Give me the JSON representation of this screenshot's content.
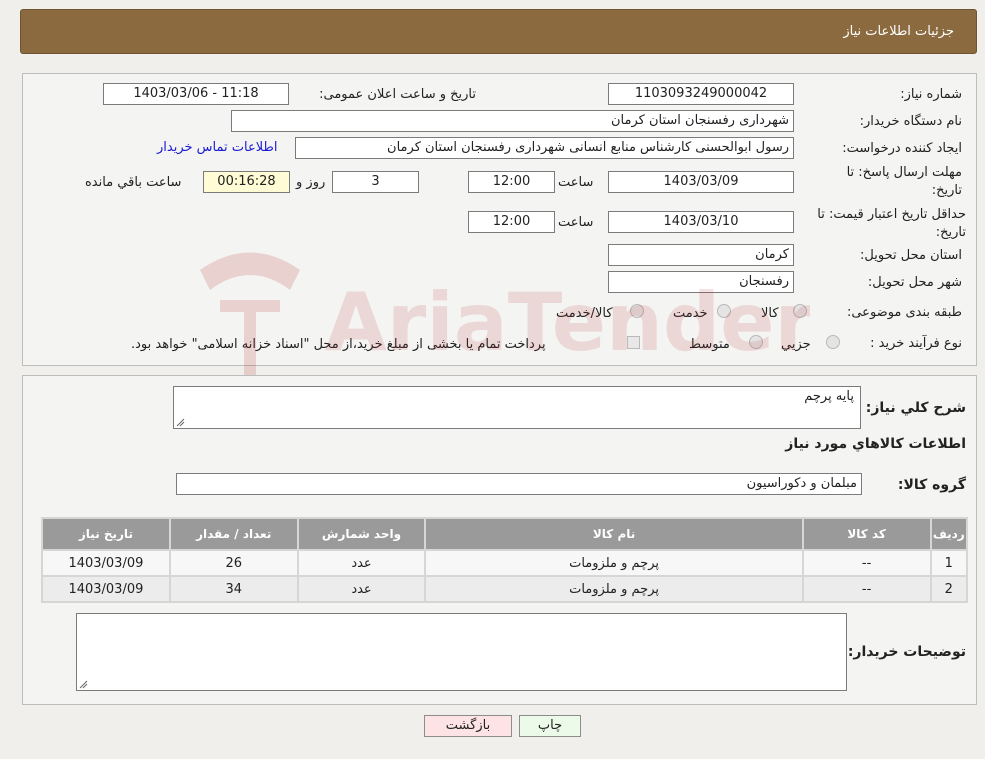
{
  "header": {
    "title": "جزئیات اطلاعات نیاز"
  },
  "form": {
    "need_number_label": "شماره نیاز:",
    "need_number": "1103093249000042",
    "announce_label": "تاریخ و ساعت اعلان عمومی:",
    "announce_value": "1403/03/06 - 11:18",
    "buyer_org_label": "نام دستگاه خریدار:",
    "buyer_org": "شهرداری رفسنجان استان کرمان",
    "requester_label": "ایجاد کننده درخواست:",
    "requester": "رسول ابوالحسنی کارشناس منابع انسانی شهرداری رفسنجان استان کرمان",
    "contact_link": "اطلاعات تماس خریدار",
    "deadline_label": "مهلت ارسال پاسخ: تا تاریخ:",
    "deadline_date": "1403/03/09",
    "time_label": "ساعت",
    "deadline_time": "12:00",
    "days_value": "3",
    "days_label": "روز و",
    "remaining_value": "00:16:28",
    "remaining_label": "ساعت باقي مانده",
    "validity_label": "حداقل تاریخ اعتبار قیمت: تا تاریخ:",
    "validity_date": "1403/03/10",
    "validity_time": "12:00",
    "province_label": "استان محل تحویل:",
    "province": "کرمان",
    "city_label": "شهر محل تحویل:",
    "city": "رفسنجان",
    "category_label": "طبقه بندی موضوعی:",
    "category_options": [
      "کالا",
      "خدمت",
      "کالا/خدمت"
    ],
    "process_label": "نوع فرآیند خرید :",
    "process_options": [
      "جزيي",
      "متوسط"
    ],
    "payment_note": "پرداخت تمام یا بخشی از مبلغ خرید،از محل \"اسناد خزانه اسلامی\" خواهد بود."
  },
  "details": {
    "summary_label": "شرح کلي نياز:",
    "summary": "پایه پرچم",
    "goods_info_title": "اطلاعات کالاهاي مورد نياز",
    "group_label": "گروه کالا:",
    "group_value": "مبلمان و دکوراسیون",
    "table": {
      "headers": [
        "رديف",
        "کد کالا",
        "نام کالا",
        "واحد شمارش",
        "تعداد / مقدار",
        "تاریخ نیاز"
      ],
      "rows": [
        [
          "1",
          "--",
          "پرچم و ملزومات",
          "عدد",
          "26",
          "1403/03/09"
        ],
        [
          "2",
          "--",
          "پرچم و ملزومات",
          "عدد",
          "34",
          "1403/03/09"
        ]
      ]
    },
    "buyer_notes_label": "توضیحات خریدار:",
    "buyer_notes": ""
  },
  "buttons": {
    "back": "بازگشت",
    "print": "چاپ"
  },
  "watermark": {
    "text": "AriaTender.neT"
  },
  "colors": {
    "header_bg": "#8b6a3f",
    "link": "#1a1ad6",
    "table_header": "#9a9a9a"
  }
}
